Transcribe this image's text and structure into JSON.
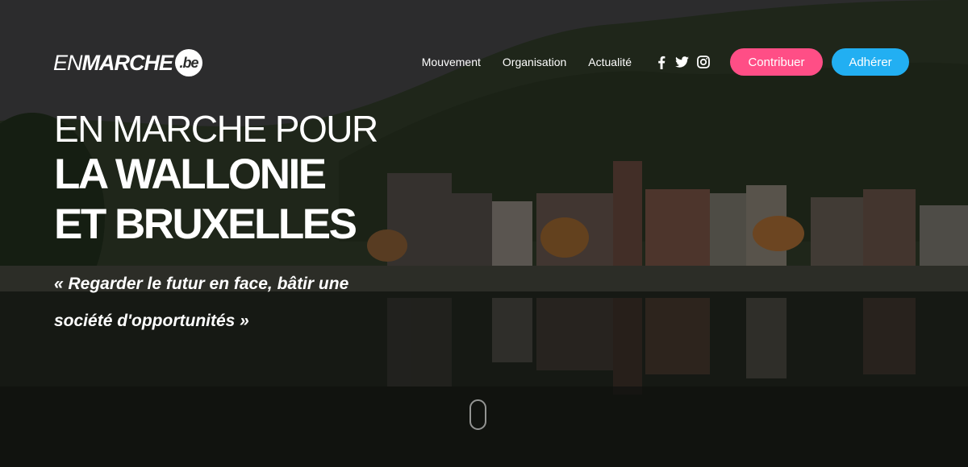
{
  "header": {
    "logo": {
      "en": "EN",
      "marche": "MARCHE",
      "be": ".be"
    },
    "nav": [
      {
        "label": "Mouvement"
      },
      {
        "label": "Organisation"
      },
      {
        "label": "Actualité"
      }
    ],
    "social": [
      "facebook-icon",
      "twitter-icon",
      "instagram-icon"
    ],
    "buttons": {
      "contribute": "Contribuer",
      "join": "Adhérer"
    }
  },
  "hero": {
    "line1": "EN MARCHE POUR",
    "line2": "LA WALLONIE",
    "line3": "ET BRUXELLES",
    "quote": "« Regarder le futur en face, bâtir une société d'opportunités »"
  },
  "colors": {
    "contribute": "#ff4e86",
    "join": "#22aff2"
  }
}
